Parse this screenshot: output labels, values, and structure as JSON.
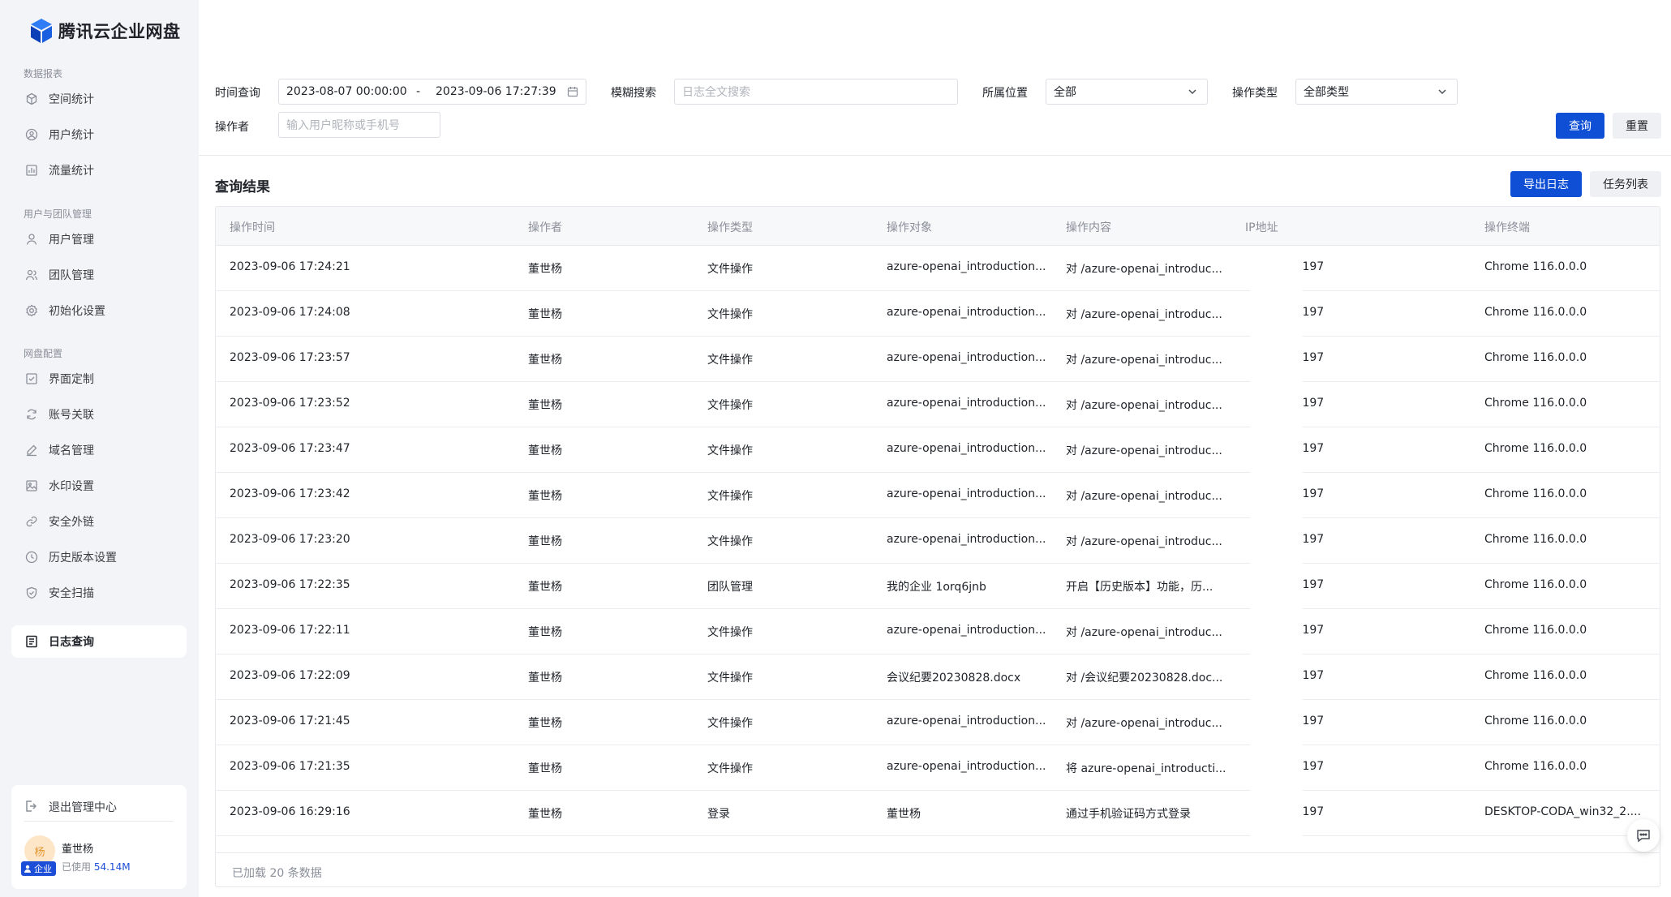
{
  "app": {
    "title": "腾讯云企业网盘"
  },
  "sidebar": {
    "groups": [
      {
        "title": "数据报表",
        "items": [
          {
            "label": "空间统计",
            "icon": "cube-icon"
          },
          {
            "label": "用户统计",
            "icon": "user-circle-icon"
          },
          {
            "label": "流量统计",
            "icon": "bar-chart-icon"
          }
        ]
      },
      {
        "title": "用户与团队管理",
        "items": [
          {
            "label": "用户管理",
            "icon": "user-icon"
          },
          {
            "label": "团队管理",
            "icon": "team-icon"
          },
          {
            "label": "初始化设置",
            "icon": "gear-icon"
          }
        ]
      },
      {
        "title": "网盘配置",
        "items": [
          {
            "label": "界面定制",
            "icon": "checkbox-icon"
          },
          {
            "label": "账号关联",
            "icon": "sync-icon"
          },
          {
            "label": "域名管理",
            "icon": "edit-icon"
          },
          {
            "label": "水印设置",
            "icon": "image-icon"
          },
          {
            "label": "安全外链",
            "icon": "link-icon"
          },
          {
            "label": "历史版本设置",
            "icon": "clock-icon"
          },
          {
            "label": "安全扫描",
            "icon": "shield-icon"
          }
        ]
      }
    ],
    "active_item": {
      "label": "日志查询",
      "icon": "log-icon"
    },
    "footer": {
      "exit_label": "退出管理中心",
      "user_name": "董世杨",
      "avatar_text": "杨",
      "badge": "企业",
      "usage_label": "已使用",
      "usage_value": "54.14M"
    }
  },
  "filters": {
    "time_label": "时间查询",
    "start": "2023-08-07 00:00:00",
    "dash": "-",
    "end": "2023-09-06 17:27:39",
    "fuzzy_label": "模糊搜索",
    "fuzzy_placeholder": "日志全文搜索",
    "location_label": "所属位置",
    "location_value": "全部",
    "type_label": "操作类型",
    "type_value": "全部类型",
    "operator_label": "操作者",
    "operator_placeholder": "输入用户昵称或手机号",
    "search_btn": "查询",
    "reset_btn": "重置"
  },
  "results": {
    "title": "查询结果",
    "export_btn": "导出日志",
    "task_btn": "任务列表",
    "columns": [
      "操作时间",
      "操作者",
      "操作类型",
      "操作对象",
      "操作内容",
      "IP地址",
      "操作终端"
    ],
    "rows": [
      [
        "2023-09-06 17:24:21",
        "董世杨",
        "文件操作",
        "azure-openai_introduction...",
        "对 /azure-openai_introduc...",
        "⁠.197",
        "Chrome 116.0.0.0"
      ],
      [
        "2023-09-06 17:24:08",
        "董世杨",
        "文件操作",
        "azure-openai_introduction...",
        "对 /azure-openai_introduc...",
        "⁠.197",
        "Chrome 116.0.0.0"
      ],
      [
        "2023-09-06 17:23:57",
        "董世杨",
        "文件操作",
        "azure-openai_introduction...",
        "对 /azure-openai_introduc...",
        "⁠.197",
        "Chrome 116.0.0.0"
      ],
      [
        "2023-09-06 17:23:52",
        "董世杨",
        "文件操作",
        "azure-openai_introduction...",
        "对 /azure-openai_introduc...",
        "⁠.197",
        "Chrome 116.0.0.0"
      ],
      [
        "2023-09-06 17:23:47",
        "董世杨",
        "文件操作",
        "azure-openai_introduction...",
        "对 /azure-openai_introduc...",
        "⁠.197",
        "Chrome 116.0.0.0"
      ],
      [
        "2023-09-06 17:23:42",
        "董世杨",
        "文件操作",
        "azure-openai_introduction...",
        "对 /azure-openai_introduc...",
        "⁠.197",
        "Chrome 116.0.0.0"
      ],
      [
        "2023-09-06 17:23:20",
        "董世杨",
        "文件操作",
        "azure-openai_introduction...",
        "对 /azure-openai_introduc...",
        "⁠.197",
        "Chrome 116.0.0.0"
      ],
      [
        "2023-09-06 17:22:35",
        "董世杨",
        "团队管理",
        "我的企业 1orq6jnb",
        "开启【历史版本】功能，历...",
        "⁠.197",
        "Chrome 116.0.0.0"
      ],
      [
        "2023-09-06 17:22:11",
        "董世杨",
        "文件操作",
        "azure-openai_introduction...",
        "对 /azure-openai_introduc...",
        "⁠.197",
        "Chrome 116.0.0.0"
      ],
      [
        "2023-09-06 17:22:09",
        "董世杨",
        "文件操作",
        "会议纪要20230828.docx",
        "对 /会议纪要20230828.doc...",
        "⁠.197",
        "Chrome 116.0.0.0"
      ],
      [
        "2023-09-06 17:21:45",
        "董世杨",
        "文件操作",
        "azure-openai_introduction...",
        "对 /azure-openai_introduc...",
        "⁠.197",
        "Chrome 116.0.0.0"
      ],
      [
        "2023-09-06 17:21:35",
        "董世杨",
        "文件操作",
        "azure-openai_introduction...",
        "将 azure-openai_introducti...",
        "⁠.197",
        "Chrome 116.0.0.0"
      ],
      [
        "2023-09-06 16:29:16",
        "董世杨",
        "登录",
        "董世杨",
        "通过手机验证码方式登录",
        "⁠.197",
        "DESKTOP-CODA_win32_2...."
      ]
    ],
    "footer": "已加载 20 条数据"
  },
  "colors": {
    "primary": "#0f4fd6",
    "sidebar_bg": "#f3f4f7"
  }
}
